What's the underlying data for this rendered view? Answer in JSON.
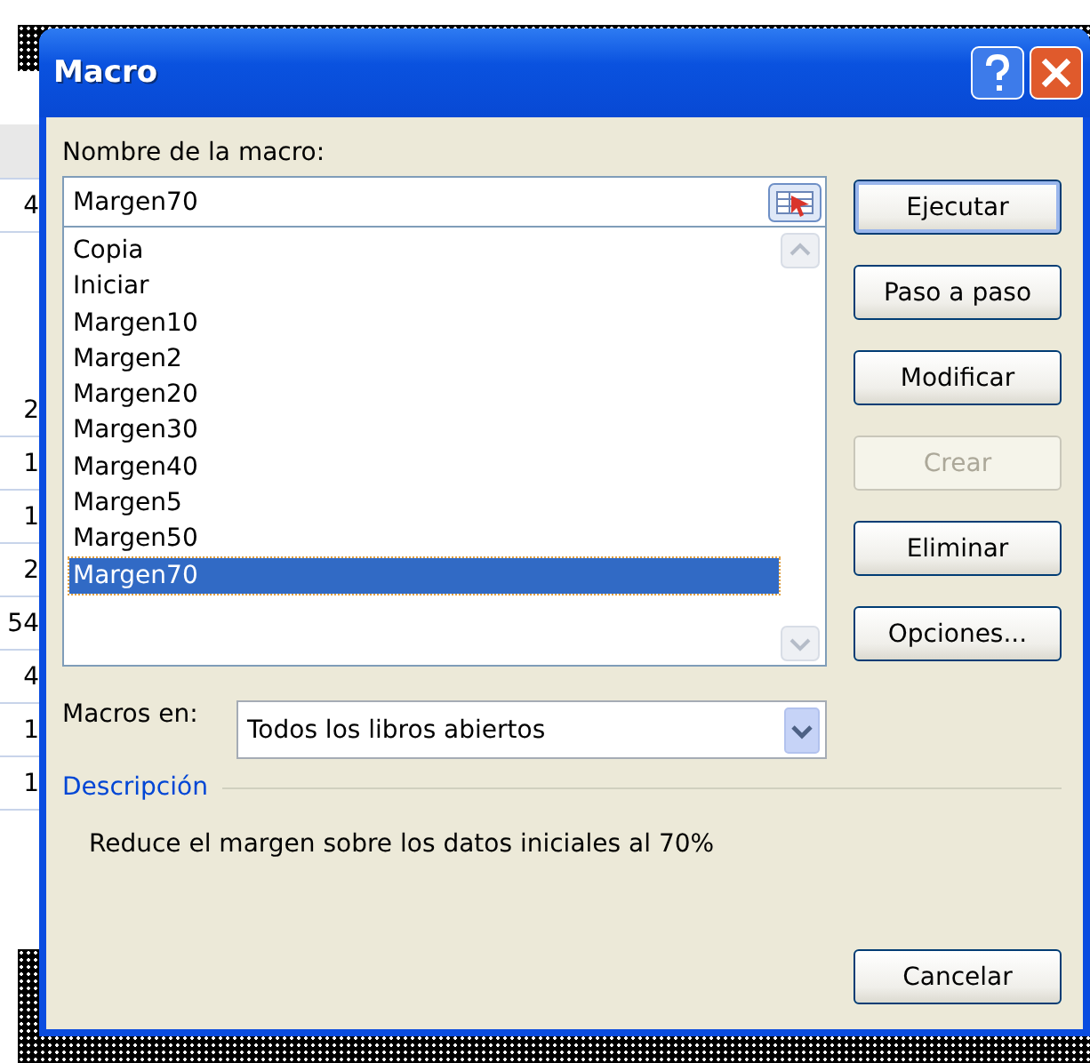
{
  "background_sheet": {
    "cells": [
      "4",
      "2",
      "1",
      "1",
      "2",
      "54",
      "4",
      "1",
      "1"
    ]
  },
  "window": {
    "title": "Macro"
  },
  "macro_name": {
    "label": "Nombre de la macro:",
    "value": "Margen70"
  },
  "macros": [
    {
      "name": "Copia",
      "selected": false
    },
    {
      "name": "Iniciar",
      "selected": false
    },
    {
      "name": "Margen10",
      "selected": false
    },
    {
      "name": "Margen2",
      "selected": false
    },
    {
      "name": "Margen20",
      "selected": false
    },
    {
      "name": "Margen30",
      "selected": false
    },
    {
      "name": "Margen40",
      "selected": false
    },
    {
      "name": "Margen5",
      "selected": false
    },
    {
      "name": "Margen50",
      "selected": false
    },
    {
      "name": "Margen70",
      "selected": true
    }
  ],
  "buttons": [
    {
      "label": "Ejecutar",
      "disabled": false,
      "default": true
    },
    {
      "label": "Paso a paso",
      "disabled": false,
      "default": false
    },
    {
      "label": "Modificar",
      "disabled": false,
      "default": false
    },
    {
      "label": "Crear",
      "disabled": true,
      "default": false
    },
    {
      "label": "Eliminar",
      "disabled": false,
      "default": false
    },
    {
      "label": "Opciones...",
      "disabled": false,
      "default": false
    }
  ],
  "macros_in": {
    "label": "Macros en:",
    "value": "Todos los libros abiertos"
  },
  "description": {
    "heading": "Descripción",
    "text": "Reduce el margen sobre los datos iniciales al 70%"
  },
  "cancel_button": {
    "label": "Cancelar"
  }
}
